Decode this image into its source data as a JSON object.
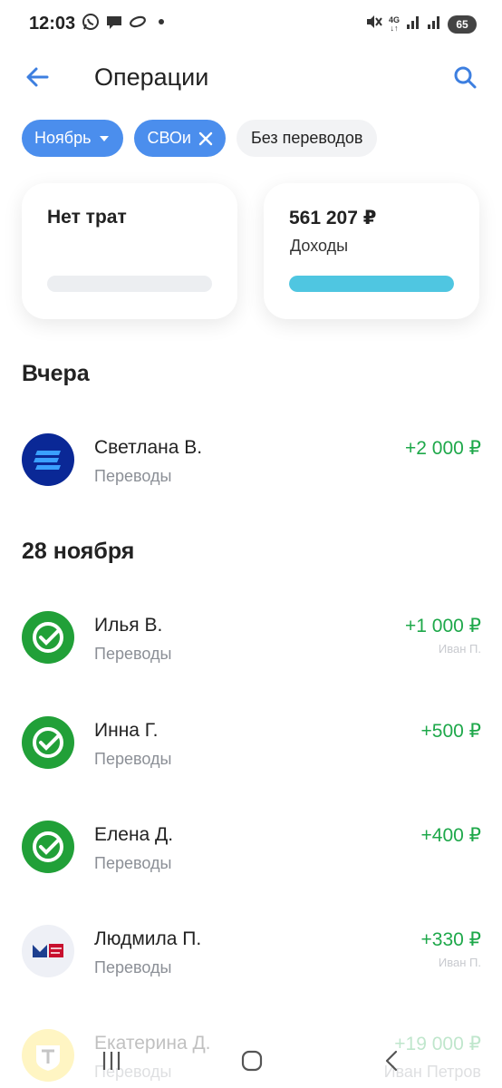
{
  "status_bar": {
    "time": "12:03",
    "left_icons": [
      "whatsapp-icon",
      "chat-icon",
      "infinity-icon",
      "dot-icon"
    ],
    "right_icons": [
      "mute-icon",
      "network-4g-icon",
      "signal-icon",
      "signal-icon-2"
    ],
    "network": "4G",
    "battery": "65"
  },
  "header": {
    "title": "Операции",
    "back_icon": "arrow-left-icon",
    "search_icon": "search-icon"
  },
  "filters": [
    {
      "label": "Ноябрь",
      "icon": "chevron-down-icon",
      "active": true
    },
    {
      "label": "СВОи",
      "icon": "close-icon",
      "active": true
    },
    {
      "label": "Без переводов",
      "active": false
    }
  ],
  "cards": {
    "spending": {
      "amount": "Нет трат",
      "progress": 0
    },
    "income": {
      "amount": "561 207 ₽",
      "label": "Доходы",
      "progress": 1.0
    }
  },
  "sections": [
    {
      "title": "Вчера",
      "items": [
        {
          "name": "Светлана В.",
          "category": "Переводы",
          "amount": "+2 000 ₽",
          "avatar": "vtb-bank-logo"
        }
      ]
    },
    {
      "title": "28 ноября",
      "items": [
        {
          "name": "Илья В.",
          "category": "Переводы",
          "amount": "+1 000 ₽",
          "note": "Иван П.",
          "avatar": "sber-bank-logo"
        },
        {
          "name": "Инна Г.",
          "category": "Переводы",
          "amount": "+500 ₽",
          "avatar": "sber-bank-logo"
        },
        {
          "name": "Елена Д.",
          "category": "Переводы",
          "amount": "+400 ₽",
          "avatar": "sber-bank-logo"
        },
        {
          "name": "Людмила П.",
          "category": "Переводы",
          "amount": "+330 ₽",
          "note": "Иван П.",
          "avatar": "pochta-bank-logo"
        },
        {
          "name": "Екатерина Д.",
          "category": "Переводы",
          "amount": "+19 000 ₽",
          "note": "Иван Петров",
          "avatar": "tinkoff-bank-logo"
        }
      ]
    }
  ],
  "colors": {
    "accent": "#4b8eed",
    "income_green": "#1ea84a",
    "income_bar": "#4fc6e1",
    "sber_green": "#21a038",
    "vtb_blue": "#0a2896"
  },
  "nav_bar": {
    "icons": [
      "recent-apps-icon",
      "home-icon",
      "back-icon"
    ]
  }
}
